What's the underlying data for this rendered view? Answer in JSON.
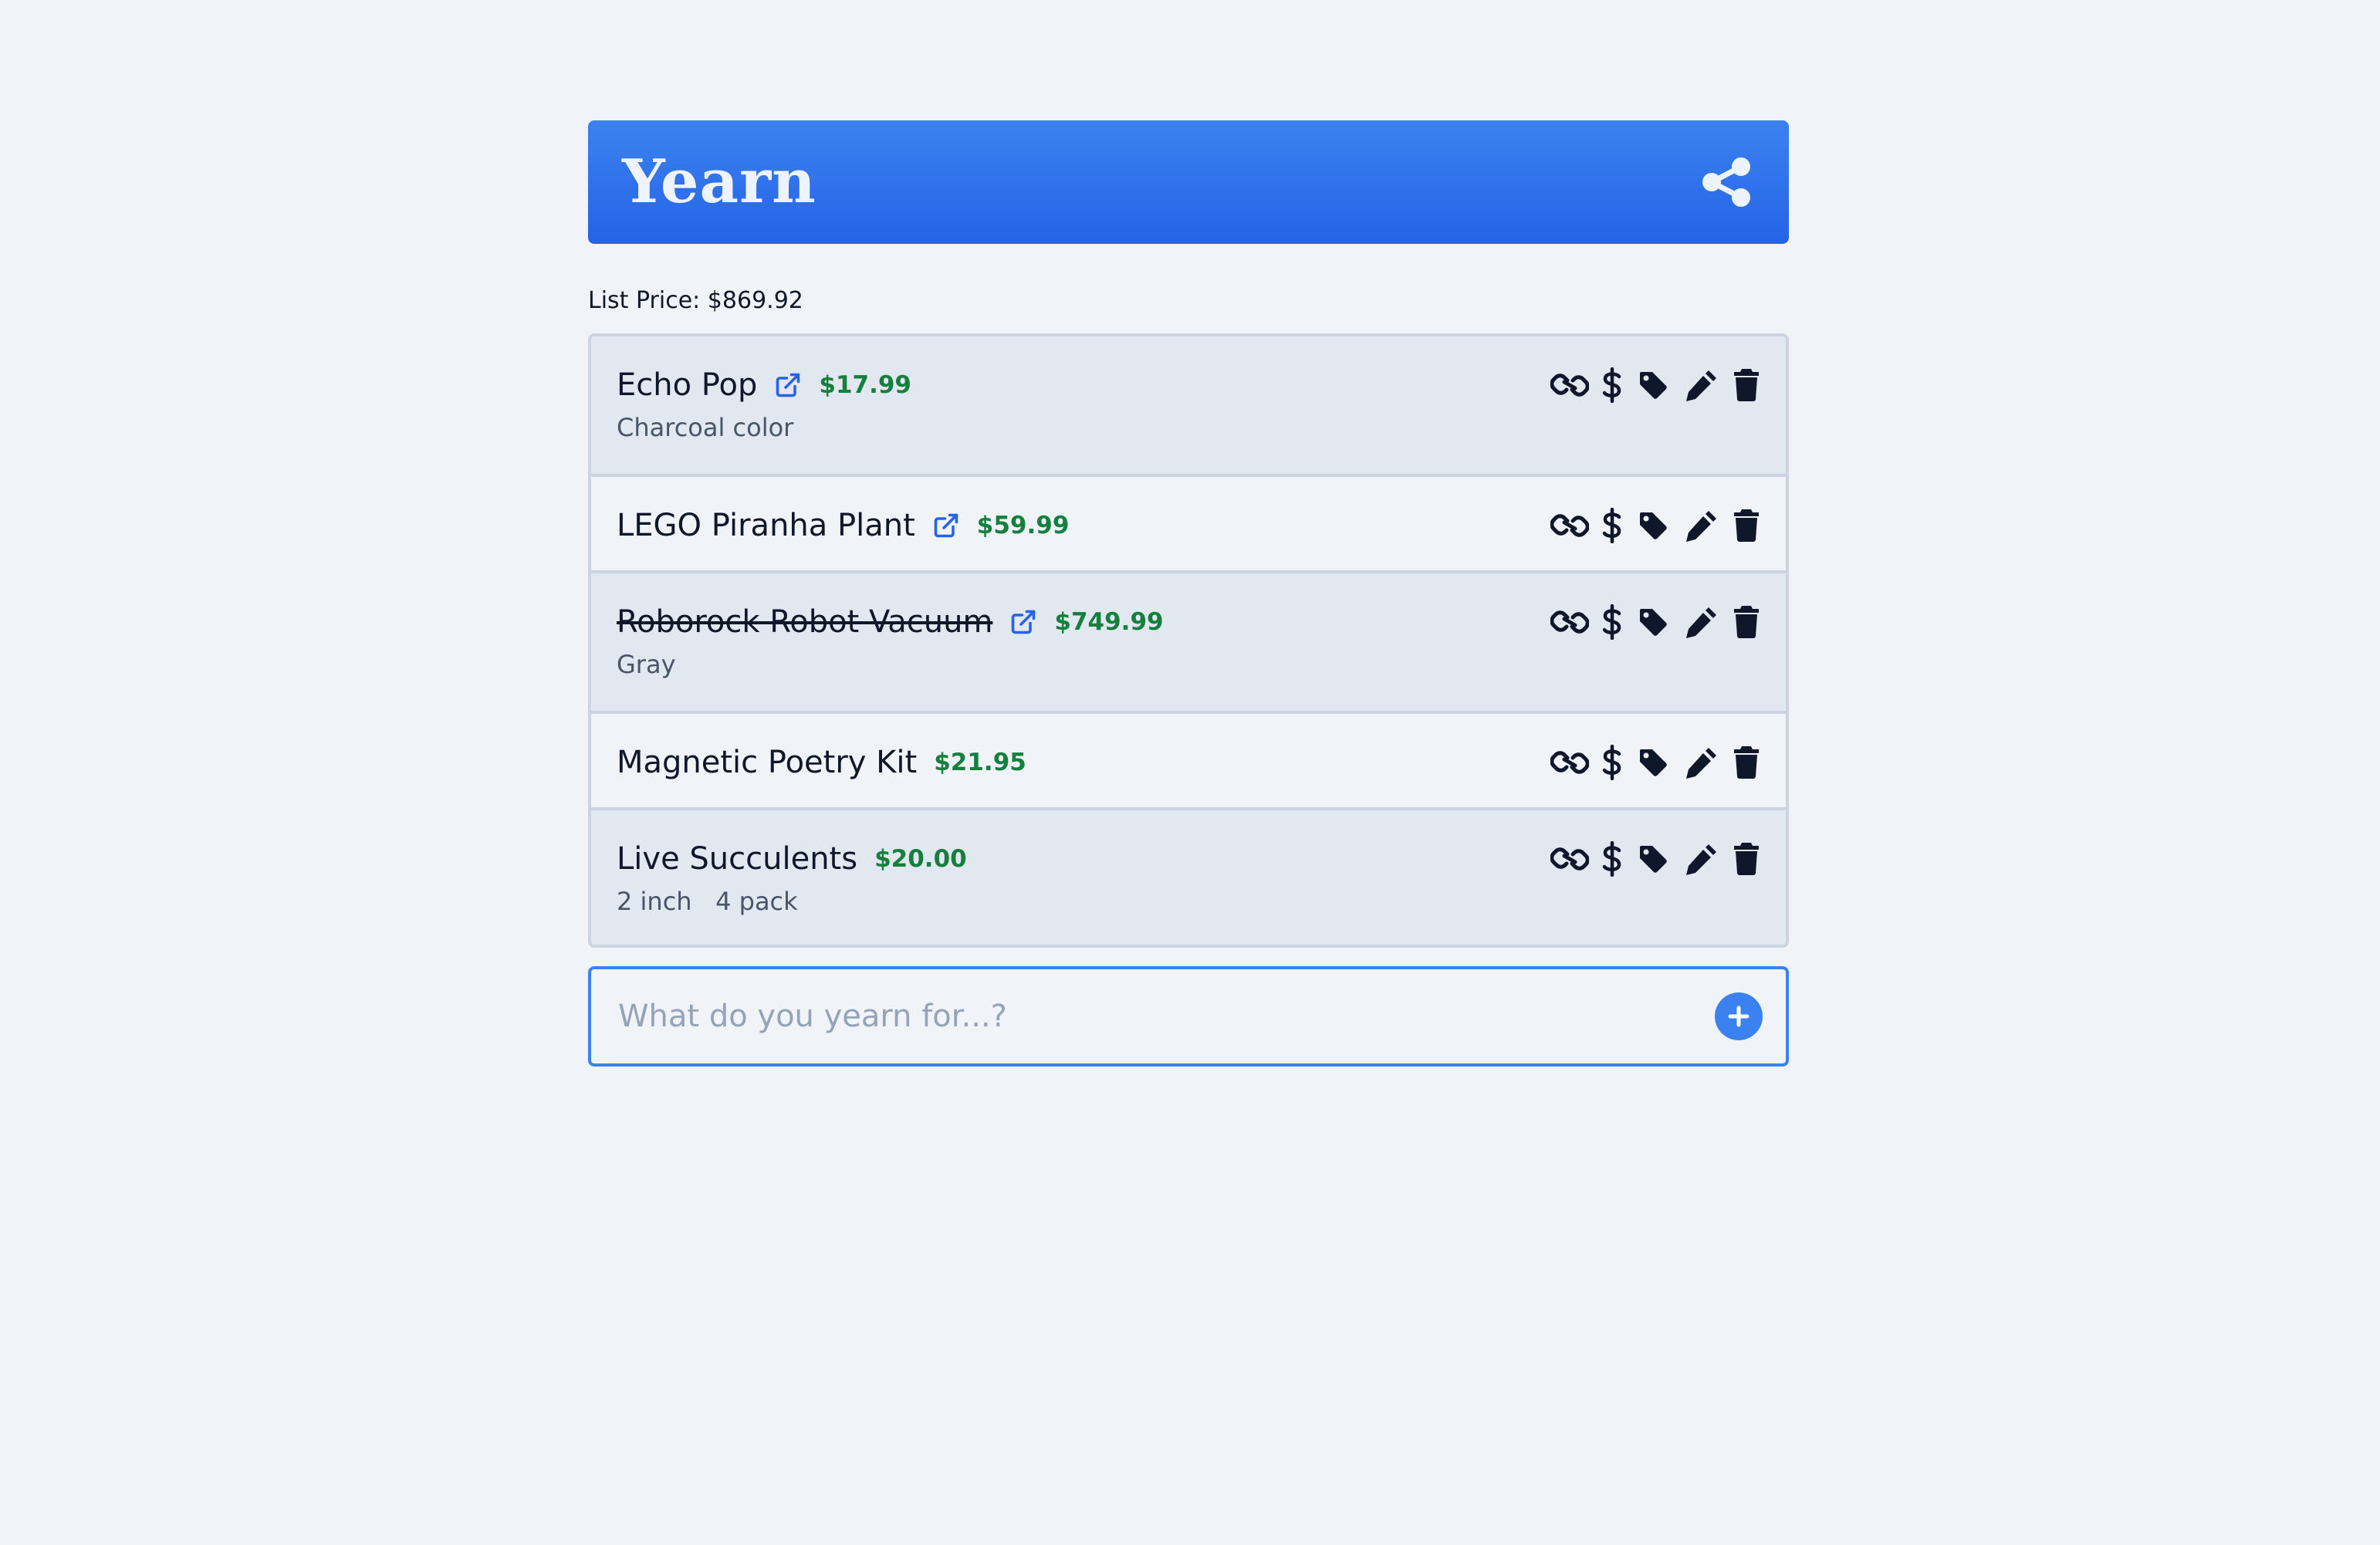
{
  "app": {
    "logo": "Yearn"
  },
  "summary": {
    "list_price": "List Price: $869.92"
  },
  "items": [
    {
      "name": "Echo Pop",
      "has_link": true,
      "price": "$17.99",
      "note": "Charcoal color",
      "purchased": false
    },
    {
      "name": "LEGO Piranha Plant",
      "has_link": true,
      "price": "$59.99",
      "note": "",
      "purchased": false
    },
    {
      "name": "Roborock Robot Vacuum",
      "has_link": true,
      "price": "$749.99",
      "note": "Gray",
      "purchased": true
    },
    {
      "name": "Magnetic Poetry Kit",
      "has_link": false,
      "price": "$21.95",
      "note": "",
      "purchased": false
    },
    {
      "name": "Live Succulents",
      "has_link": false,
      "price": "$20.00",
      "note": "2 inch   4 pack",
      "purchased": false
    }
  ],
  "add": {
    "placeholder": "What do you yearn for...?",
    "value": ""
  },
  "colors": {
    "header": "#2563e6",
    "price": "#15803d",
    "link": "#2563eb",
    "accent": "#3b82f0"
  },
  "icons": {
    "share": "share-icon",
    "external": "external-link-icon",
    "link": "link-icon",
    "dollar": "dollar-icon",
    "tag": "tag-icon",
    "edit": "pencil-icon",
    "delete": "trash-icon",
    "add": "plus-icon"
  }
}
